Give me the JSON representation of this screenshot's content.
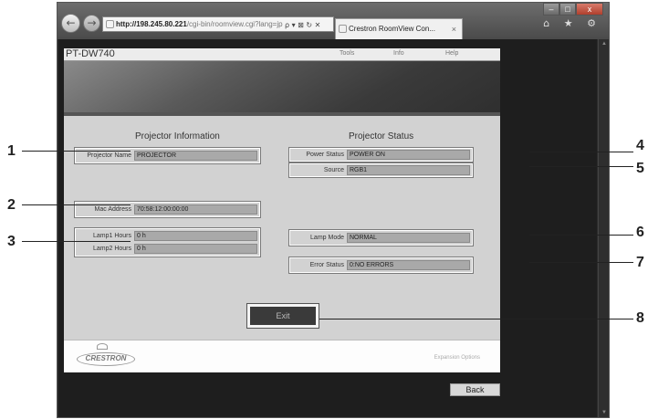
{
  "browser": {
    "back_icon": "←",
    "forward_icon": "→",
    "url_host": "http://198.245.80.221",
    "url_path": "/cgi-bin/roomview.cgi?lang=jp",
    "address_tools": "ρ ▾ ⊠ ↻ ✕",
    "tab_title": "Crestron RoomView Con...",
    "tab_close": "×",
    "right_icons": "⌂ ★ ⚙",
    "win_minimize": "–",
    "win_maximize": "□",
    "win_close": "x",
    "scroll_up": "▲",
    "scroll_down": "▼"
  },
  "header": {
    "model": "PT-DW740",
    "menu": [
      "Tools",
      "Info",
      "Help"
    ]
  },
  "projector_information": {
    "title": "Projector Information",
    "projector_name_label": "Projector Name",
    "projector_name": "PROJECTOR",
    "mac_address_label": "Mac Address",
    "mac_address": "70:58:12:00:00:00",
    "lamp1_label": "Lamp1 Hours",
    "lamp1_value": "0 h",
    "lamp2_label": "Lamp2 Hours",
    "lamp2_value": "0 h"
  },
  "projector_status": {
    "title": "Projector Status",
    "power_label": "Power Status",
    "power_value": "POWER ON",
    "source_label": "Source",
    "source_value": "RGB1",
    "lamp_mode_label": "Lamp Mode",
    "lamp_mode_value": "NORMAL",
    "error_label": "Error Status",
    "error_value": "0:NO ERRORS"
  },
  "actions": {
    "exit_label": "Exit",
    "back_label": "Back"
  },
  "footer": {
    "logo_text": "CRESTRON",
    "expansion_options": "Expansion Options"
  },
  "callouts": [
    "1",
    "2",
    "3",
    "4",
    "5",
    "6",
    "7",
    "8"
  ]
}
